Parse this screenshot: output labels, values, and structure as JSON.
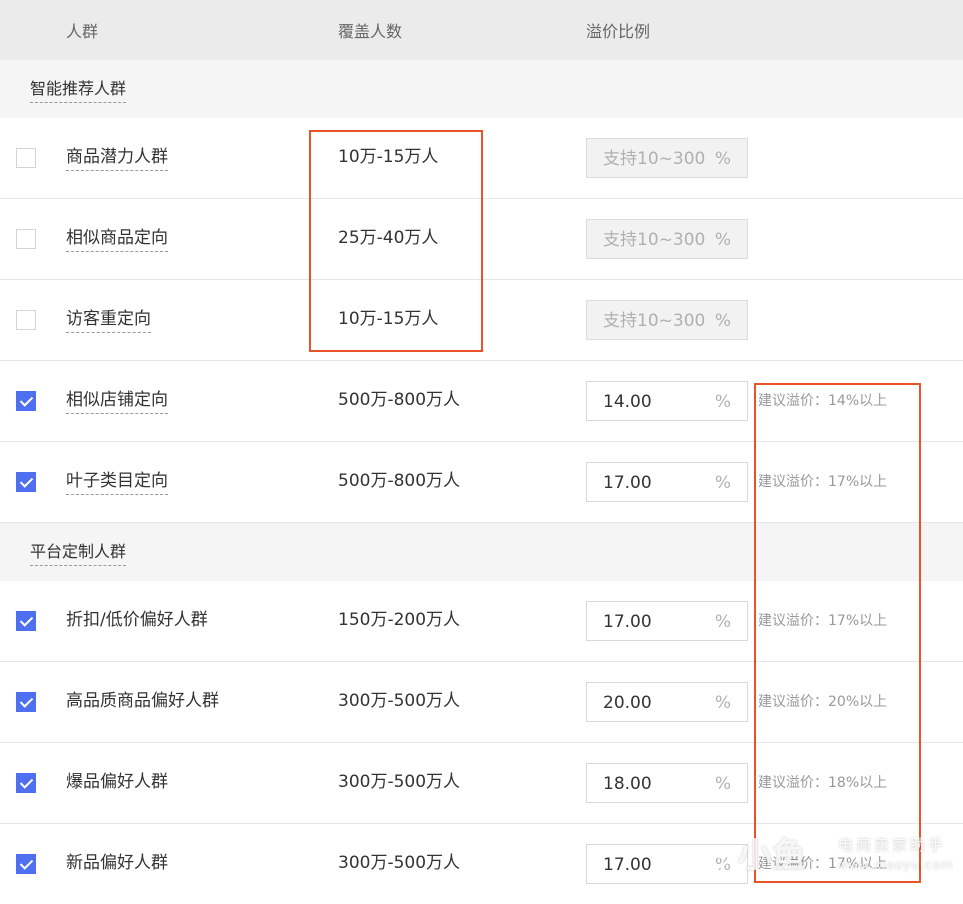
{
  "header": {
    "col_group": "人群",
    "col_coverage": "覆盖人数",
    "col_premium": "溢价比例"
  },
  "sections": [
    {
      "title": "智能推荐人群",
      "rows": [
        {
          "name": "商品潜力人群",
          "checked": false,
          "coverage": "10万-15万人",
          "value": "支持10~300",
          "unit": "%",
          "disabled": true,
          "hint": ""
        },
        {
          "name": "相似商品定向",
          "checked": false,
          "coverage": "25万-40万人",
          "value": "支持10~300",
          "unit": "%",
          "disabled": true,
          "hint": ""
        },
        {
          "name": "访客重定向",
          "checked": false,
          "coverage": "10万-15万人",
          "value": "支持10~300",
          "unit": "%",
          "disabled": true,
          "hint": ""
        },
        {
          "name": "相似店铺定向",
          "checked": true,
          "coverage": "500万-800万人",
          "value": "14.00",
          "unit": "%",
          "disabled": false,
          "hint": "建议溢价：14%以上"
        },
        {
          "name": "叶子类目定向",
          "checked": true,
          "coverage": "500万-800万人",
          "value": "17.00",
          "unit": "%",
          "disabled": false,
          "hint": "建议溢价：17%以上"
        }
      ]
    },
    {
      "title": "平台定制人群",
      "rows": [
        {
          "name": "折扣/低价偏好人群",
          "checked": true,
          "coverage": "150万-200万人",
          "value": "17.00",
          "unit": "%",
          "disabled": false,
          "hint": "建议溢价：17%以上"
        },
        {
          "name": "高品质商品偏好人群",
          "checked": true,
          "coverage": "300万-500万人",
          "value": "20.00",
          "unit": "%",
          "disabled": false,
          "hint": "建议溢价：20%以上"
        },
        {
          "name": "爆品偏好人群",
          "checked": true,
          "coverage": "300万-500万人",
          "value": "18.00",
          "unit": "%",
          "disabled": false,
          "hint": "建议溢价：18%以上"
        },
        {
          "name": "新品偏好人群",
          "checked": true,
          "coverage": "300万-500万人",
          "value": "17.00",
          "unit": "%",
          "disabled": false,
          "hint": "建议溢价：17%以上"
        }
      ]
    }
  ],
  "watermark": {
    "brand": "小鱼",
    "tag": "电商卖家助手",
    "url": "www.xiaoyu.com"
  },
  "colors": {
    "checkbox_checked": "#4d6ff0",
    "annotation_box": "#e8532a",
    "header_bg": "#ebebeb",
    "section_bg": "#f5f5f5"
  }
}
